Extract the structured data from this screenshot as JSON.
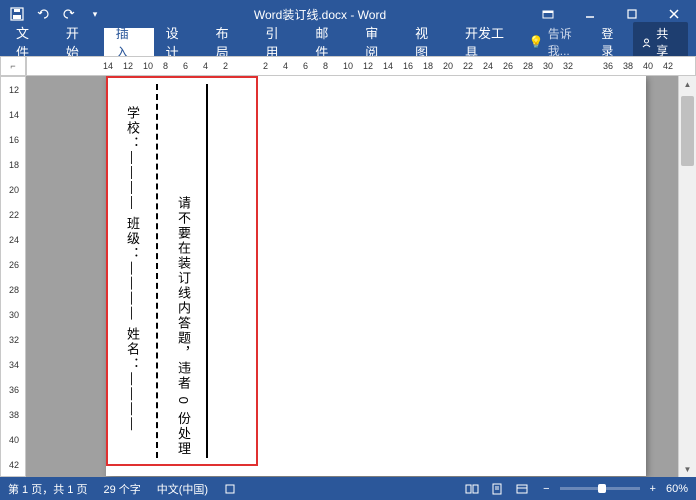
{
  "titlebar": {
    "title": "Word装订线.docx - Word"
  },
  "ribbon": {
    "tabs": [
      "文件",
      "开始",
      "插入",
      "设计",
      "布局",
      "引用",
      "邮件",
      "审阅",
      "视图",
      "开发工具"
    ],
    "active_index": 2,
    "tell_me": "告诉我...",
    "login": "登录",
    "share": "共享"
  },
  "h_ruler_ticks": [
    "14",
    "12",
    "10",
    "8",
    "6",
    "4",
    "2",
    "",
    "2",
    "4",
    "6",
    "8",
    "10",
    "12",
    "14",
    "16",
    "18",
    "20",
    "22",
    "24",
    "26",
    "28",
    "30",
    "32",
    "",
    "36",
    "38",
    "40",
    "42"
  ],
  "v_ruler_ticks": [
    "12",
    "14",
    "16",
    "18",
    "20",
    "22",
    "24",
    "26",
    "28",
    "30",
    "32",
    "34",
    "36",
    "38",
    "40",
    "42"
  ],
  "document": {
    "binding_left_text": "学校：————   班级：————   姓名：————",
    "binding_right_text": "请不要在装订线内答题，违者 0 份处理"
  },
  "statusbar": {
    "page_info": "第 1 页，共 1 页",
    "words": "29 个字",
    "language": "中文(中国)",
    "zoom": "60%"
  }
}
